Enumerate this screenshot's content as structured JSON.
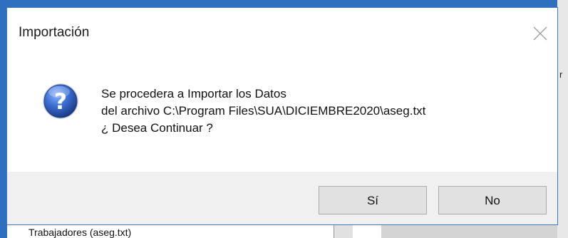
{
  "dialog": {
    "title": "Importación",
    "close_icon": "close-icon",
    "icon": "question-icon",
    "message_lines": [
      "Se procedera a Importar los Datos",
      "del archivo C:\\Program Files\\SUA\\DICIEMBRE2020\\aseg.txt",
      "¿ Desea Continuar ?"
    ],
    "buttons": {
      "yes_label": "Sí",
      "no_label": "No"
    }
  },
  "background": {
    "partial_field_text": "Trabajadores (aseg.txt)",
    "right_edge_text": "r"
  },
  "colors": {
    "desktop_blue": "#2f6fbf",
    "dialog_bg": "#ffffff",
    "button_area_bg": "#f0f0f0",
    "icon_blue": "#2a5db0"
  }
}
